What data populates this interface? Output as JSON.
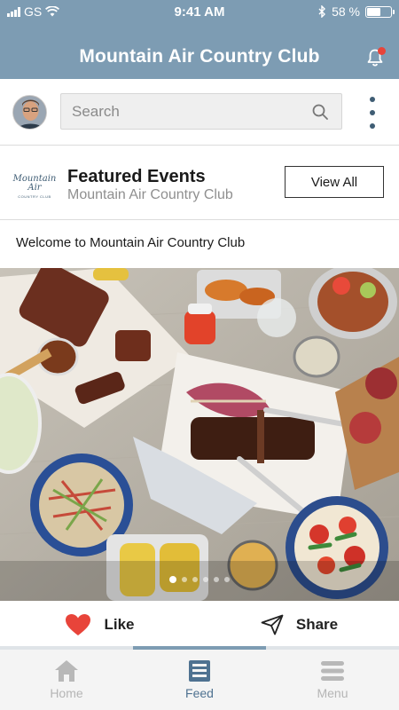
{
  "status_bar": {
    "carrier": "GS",
    "time": "9:41 AM",
    "battery": "58 %",
    "battery_level": 0.58
  },
  "header": {
    "title": "Mountain Air Country Club",
    "notification_icon": "bell-icon",
    "has_unread": true
  },
  "search": {
    "placeholder": "Search",
    "value": ""
  },
  "featured": {
    "logo_text": "Mountain Air",
    "logo_subtext": "COUNTRY CLUB",
    "title": "Featured Events",
    "subtitle": "Mountain Air Country Club",
    "button_label": "View All"
  },
  "post": {
    "text": "Welcome to Mountain Air Country Club",
    "image_count": 6,
    "active_image": 1
  },
  "actions": {
    "like_label": "Like",
    "share_label": "Share"
  },
  "tabs": [
    {
      "label": "Home",
      "icon": "home-icon",
      "active": false
    },
    {
      "label": "Feed",
      "icon": "feed-icon",
      "active": true
    },
    {
      "label": "Menu",
      "icon": "menu-icon",
      "active": false
    }
  ],
  "colors": {
    "header": "#7d9cb3",
    "accent": "#4f7291",
    "like": "#e8443a"
  }
}
